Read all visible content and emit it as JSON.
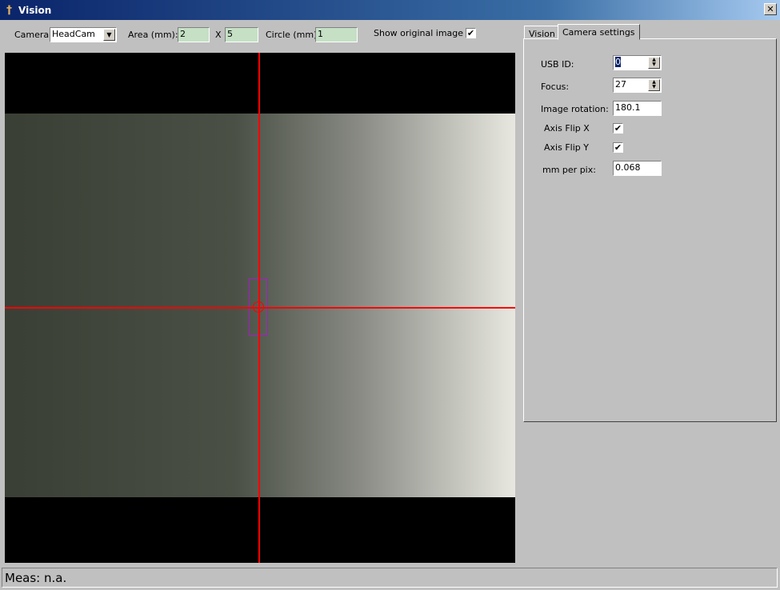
{
  "window": {
    "title": "Vision",
    "close_label": "✕"
  },
  "toolbar": {
    "camera_label": "Camera:",
    "camera_value": "HeadCam",
    "area_label": "Area (mm):",
    "area_w": "2",
    "area_x": "X",
    "area_h": "5",
    "circle_label": "Circle (mm):",
    "circle_value": "1",
    "show_original_label": "Show original image",
    "show_original_checked": true
  },
  "tabs": [
    {
      "label": "Vision",
      "active": false
    },
    {
      "label": "Camera settings",
      "active": true
    }
  ],
  "camera_settings": {
    "usb_id_label": "USB ID:",
    "usb_id_value": "0",
    "focus_label": "Focus:",
    "focus_value": "27",
    "rotation_label": "Image rotation:",
    "rotation_value": "180.1",
    "flip_x_label": "Axis Flip X",
    "flip_x_checked": true,
    "flip_y_label": "Axis Flip Y",
    "flip_y_checked": true,
    "mm_per_pix_label": "mm per pix:",
    "mm_per_pix_value": "0.068"
  },
  "status": {
    "text": "Meas: n.a."
  },
  "colors": {
    "crosshair": "#ff0000",
    "field_bg": "#c5e0c5",
    "title_bar": "#0a246a"
  }
}
